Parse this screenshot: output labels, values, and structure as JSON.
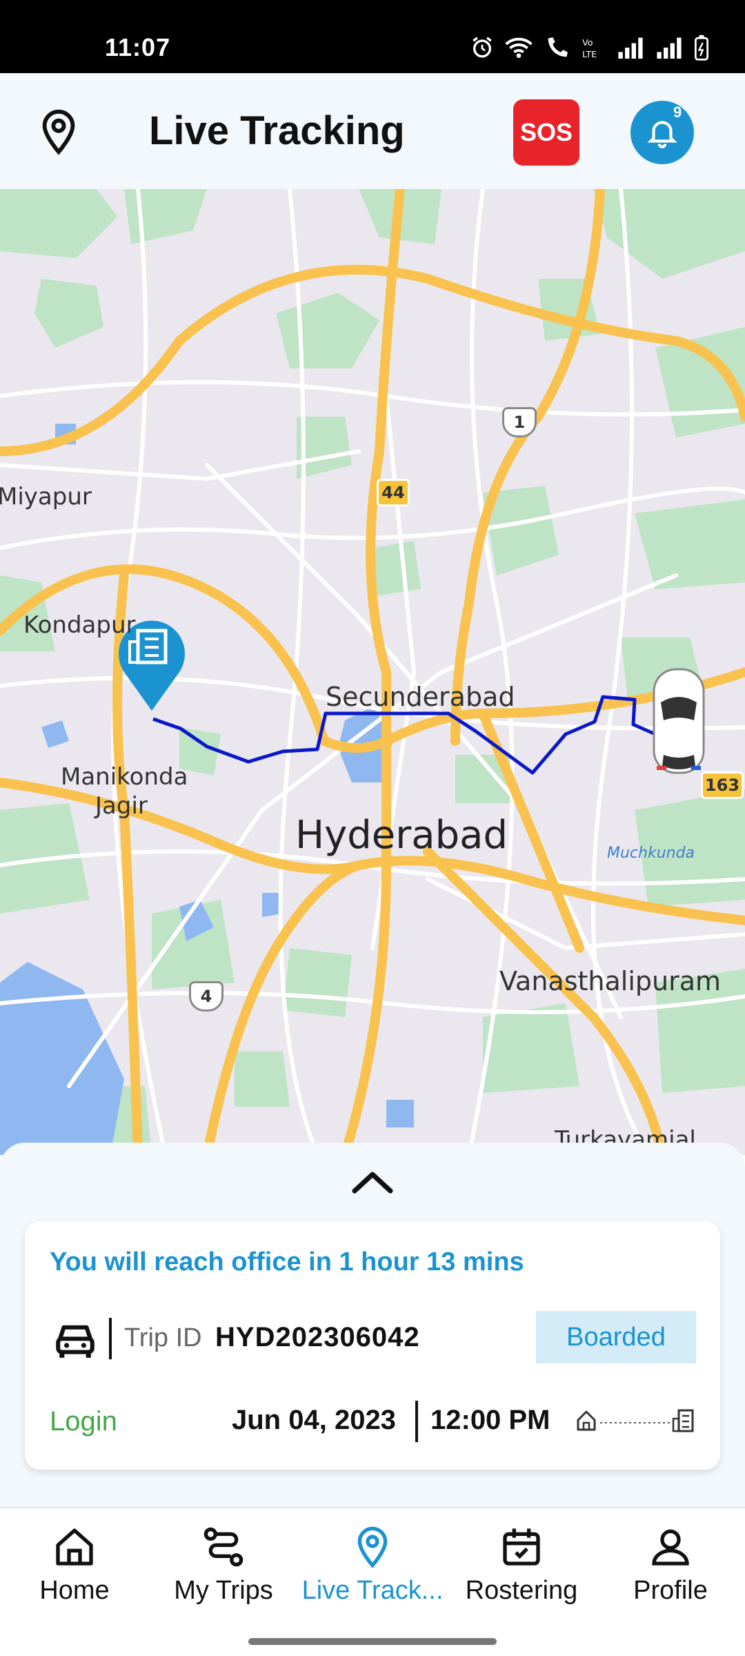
{
  "status_bar": {
    "time": "11:07"
  },
  "header": {
    "title": "Live Tracking",
    "sos_label": "SOS",
    "notification_count": "9"
  },
  "map": {
    "labels": {
      "miyapur": "Miyapur",
      "kondapur": "Kondapur",
      "manikonda": "Manikonda",
      "jagir": "Jagir",
      "secunderabad": "Secunderabad",
      "hyderabad": "Hyderabad",
      "vanasthalipuram": "Vanasthalipuram",
      "muchkunda": "Muchkunda",
      "turkayamjal": "Turkayamjal"
    },
    "shields": {
      "nh1": "1",
      "nh44": "44",
      "nh4": "4",
      "nh163": "163"
    },
    "route_color": "#0a18c8",
    "office_marker_color": "#1b93d1"
  },
  "trip_card": {
    "eta_text": "You will reach office in 1 hour 13 mins",
    "trip_id_label": "Trip ID",
    "trip_id_value": "HYD202306042",
    "status": "Boarded",
    "trip_type": "Login",
    "date": "Jun 04, 2023",
    "time": "12:00 PM"
  },
  "bottom_nav": {
    "items": [
      {
        "label": "Home",
        "icon": "home-icon"
      },
      {
        "label": "My Trips",
        "icon": "route-icon"
      },
      {
        "label": "Live Track...",
        "icon": "location-pin-icon",
        "active": true
      },
      {
        "label": "Rostering",
        "icon": "calendar-check-icon"
      },
      {
        "label": "Profile",
        "icon": "person-icon"
      }
    ]
  },
  "colors": {
    "accent": "#1b93d1",
    "sos": "#e8232a",
    "login_green": "#45a84a"
  }
}
